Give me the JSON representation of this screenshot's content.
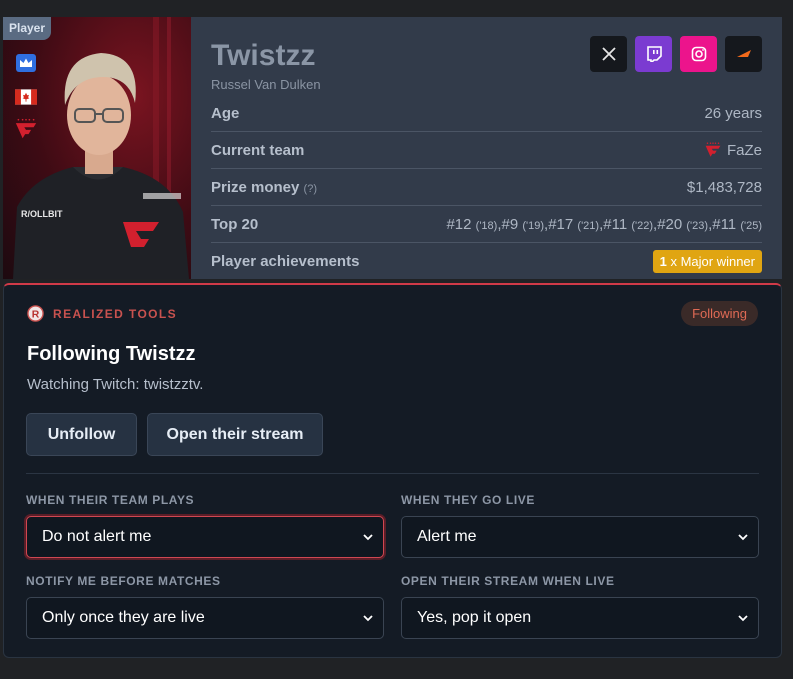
{
  "player": {
    "tag": "Player",
    "name": "Twistzz",
    "real_name": "Russel Van Dulken",
    "rows": {
      "age": {
        "label": "Age",
        "value": "26 years"
      },
      "team": {
        "label": "Current team",
        "value": "FaZe"
      },
      "prize": {
        "label": "Prize money",
        "hint": "(?)",
        "value": "$1,483,728"
      },
      "top20": {
        "label": "Top 20",
        "entries": [
          {
            "rank": "#12",
            "year": "('18)"
          },
          {
            "rank": "#9",
            "year": "('19)"
          },
          {
            "rank": "#17",
            "year": "('21)"
          },
          {
            "rank": "#11",
            "year": "('22)"
          },
          {
            "rank": "#20",
            "year": "('23)"
          },
          {
            "rank": "#11",
            "year": "('25)"
          }
        ]
      },
      "achievements": {
        "label": "Player achievements",
        "badge_count": "1",
        "badge_text": "x Major winner"
      }
    },
    "socials": [
      "x-icon",
      "twitch-icon",
      "instagram-icon",
      "faceit-icon"
    ],
    "side_icons": [
      "crown-icon",
      "canada-flag-icon",
      "faze-logo-icon"
    ]
  },
  "tools": {
    "brand": "REALIZED TOOLS",
    "status_pill": "Following",
    "title": "Following Twistzz",
    "subtitle": "Watching Twitch: twistzztv.",
    "buttons": {
      "unfollow": "Unfollow",
      "open_stream": "Open their stream"
    },
    "fields": [
      {
        "label": "WHEN THEIR TEAM PLAYS",
        "value": "Do not alert me"
      },
      {
        "label": "WHEN THEY GO LIVE",
        "value": "Alert me"
      },
      {
        "label": "NOTIFY ME BEFORE MATCHES",
        "value": "Only once they are live"
      },
      {
        "label": "OPEN THEIR STREAM WHEN LIVE",
        "value": "Yes, pop it open"
      }
    ]
  },
  "colors": {
    "accent_red": "#d03a48",
    "major_gold": "#e0a512",
    "twitch": "#7b3bd1",
    "instagram": "#ec148c"
  }
}
